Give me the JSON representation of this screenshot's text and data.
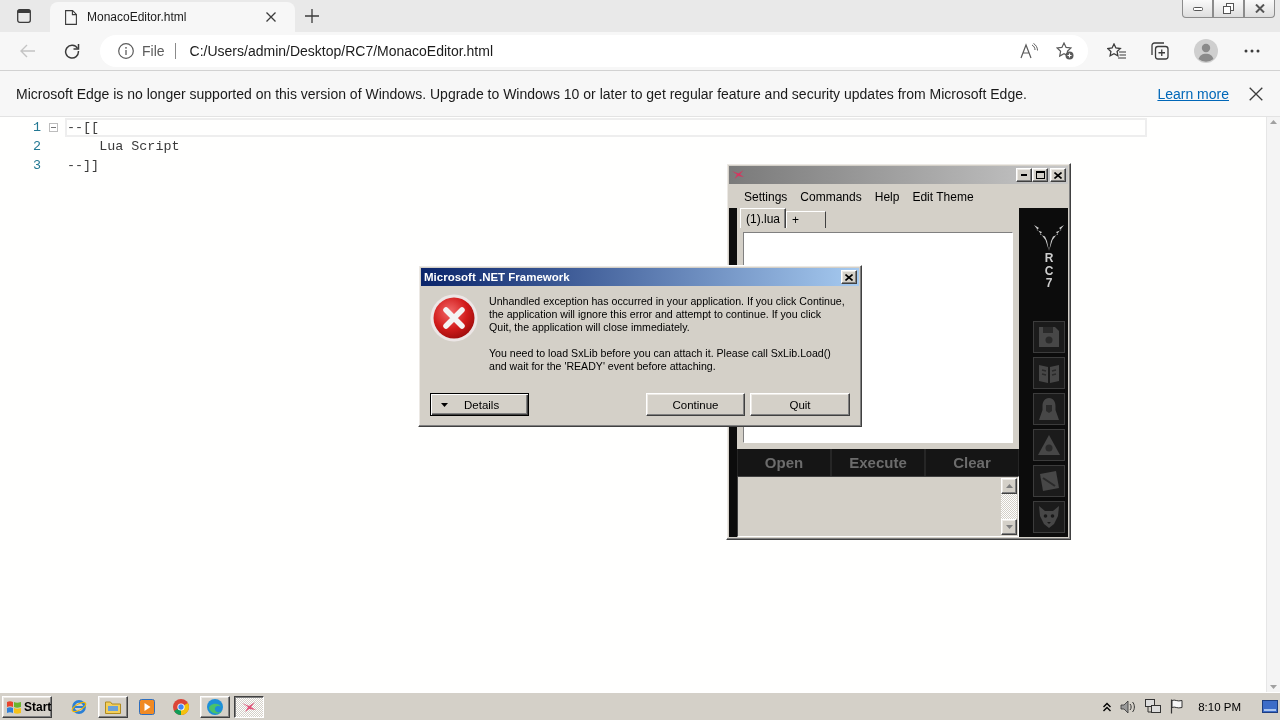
{
  "browser": {
    "tab": {
      "title": "MonacoEditor.html"
    },
    "back_disabled": true,
    "address": {
      "scheme": "File",
      "url": "C:/Users/admin/Desktop/RC7/MonacoEditor.html"
    }
  },
  "info_bar": {
    "message": "Microsoft Edge is no longer supported on this version of Windows. Upgrade to Windows 10 or later to get regular feature and security updates from Microsoft Edge.",
    "link": "Learn more"
  },
  "editor": {
    "lines": [
      {
        "number": "1",
        "text": "--[[",
        "foldable": true,
        "current": true
      },
      {
        "number": "2",
        "text": "    Lua Script",
        "foldable": false,
        "current": false
      },
      {
        "number": "3",
        "text": "--]]",
        "foldable": false,
        "current": false
      }
    ]
  },
  "rc7_window": {
    "menu": [
      "Settings",
      "Commands",
      "Help",
      "Edit Theme"
    ],
    "tabs": [
      {
        "label": "(1).lua",
        "selected": true
      },
      {
        "label": "+",
        "selected": false
      }
    ],
    "logo": "RC7",
    "actions": [
      "Open",
      "Execute",
      "Clear"
    ]
  },
  "dialog": {
    "title": "Microsoft .NET Framework",
    "paragraphs": [
      "Unhandled exception has occurred in your application. If you click Continue, the application will ignore this error and attempt to continue. If you click Quit, the application will close immediately.",
      "You need to load SxLib before you can attach it. Please call SxLib.Load() and wait for the 'READY' event before attaching."
    ],
    "details_button": "Details",
    "buttons": [
      "Continue",
      "Quit"
    ]
  },
  "taskbar": {
    "start": "Start",
    "apps": [
      {
        "kind": "globe",
        "open": false,
        "selected": false
      },
      {
        "kind": "folder",
        "open": true,
        "selected": false
      },
      {
        "kind": "player",
        "open": false,
        "selected": false
      },
      {
        "kind": "wheel",
        "open": false,
        "selected": false
      },
      {
        "kind": "swirl",
        "open": true,
        "selected": false
      },
      {
        "kind": "bird",
        "open": true,
        "selected": true
      }
    ],
    "clock": "8:10 PM"
  }
}
